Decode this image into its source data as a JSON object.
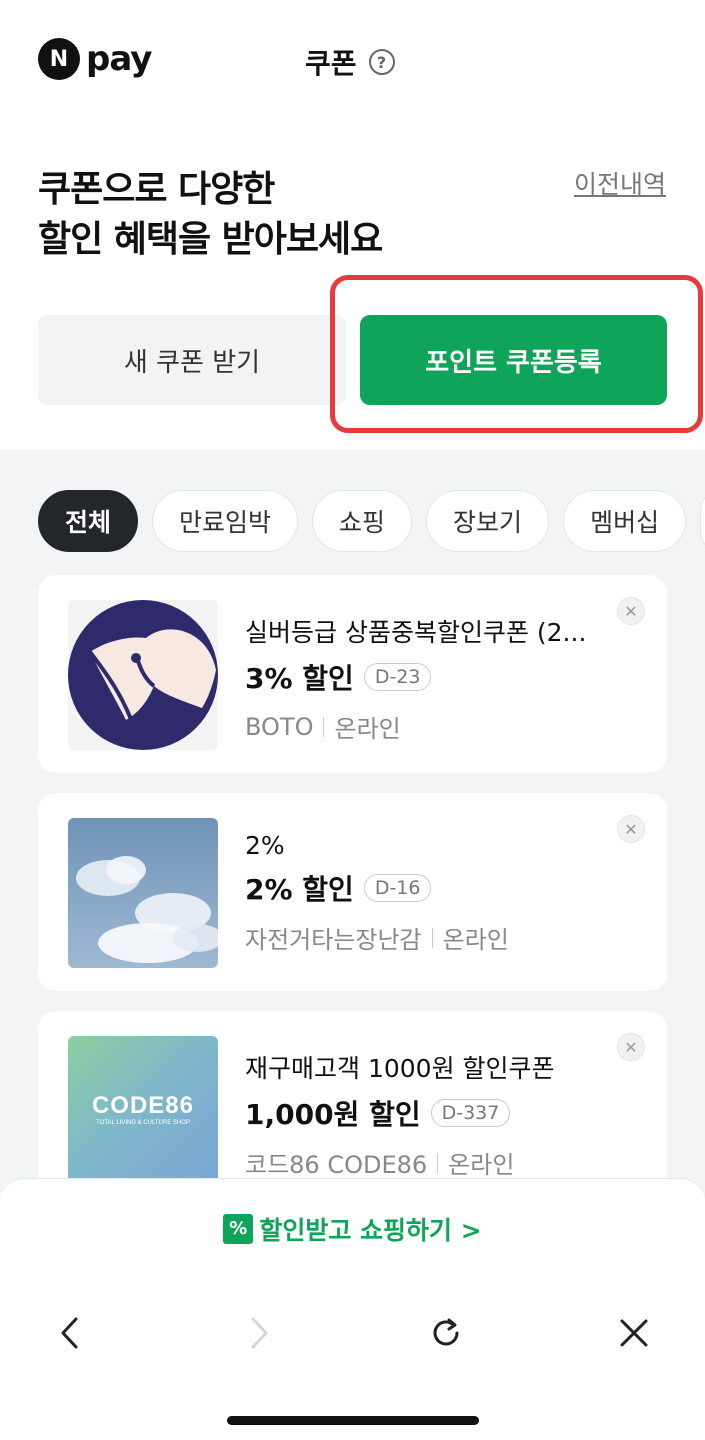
{
  "header": {
    "logo_letter": "N",
    "logo_text": "pay",
    "title": "쿠폰",
    "help_icon": "?"
  },
  "hero": {
    "headline_line1": "쿠폰으로 다양한",
    "headline_line2": "할인 혜택을 받아보세요",
    "history_link": "이전내역"
  },
  "actions": {
    "new_coupon": "새 쿠폰 받기",
    "register_coupon": "포인트 쿠폰등록"
  },
  "filters": [
    {
      "label": "전체",
      "active": true
    },
    {
      "label": "만료임박",
      "active": false
    },
    {
      "label": "쇼핑",
      "active": false
    },
    {
      "label": "장보기",
      "active": false
    },
    {
      "label": "멤버십",
      "active": false
    },
    {
      "label": "",
      "active": false
    }
  ],
  "coupons": [
    {
      "name": "실버등급 상품중복할인쿠폰 (2...",
      "amount": "3% 할인",
      "dday": "D-23",
      "store": "BOTO",
      "channel": "온라인",
      "thumb": "boto-logo"
    },
    {
      "name": "2%",
      "amount": "2% 할인",
      "dday": "D-16",
      "store": "자전거타는장난감",
      "channel": "온라인",
      "thumb": "sky-clouds"
    },
    {
      "name": "재구매고객 1000원 할인쿠폰",
      "amount": "1,000원 할인",
      "dday": "D-337",
      "store": "코드86 CODE86",
      "channel": "온라인",
      "thumb": "code86-logo",
      "thumb_title": "CODE86",
      "thumb_subtitle": "TOTAL LIVING & CULTURE SHOP"
    }
  ],
  "cta": {
    "badge": "%",
    "label": "할인받고 쇼핑하기 >"
  },
  "colors": {
    "accent": "#0ea55b",
    "highlight": "#e83a3a"
  },
  "nav_icons": [
    "back-icon",
    "forward-icon",
    "refresh-icon",
    "close-icon"
  ]
}
